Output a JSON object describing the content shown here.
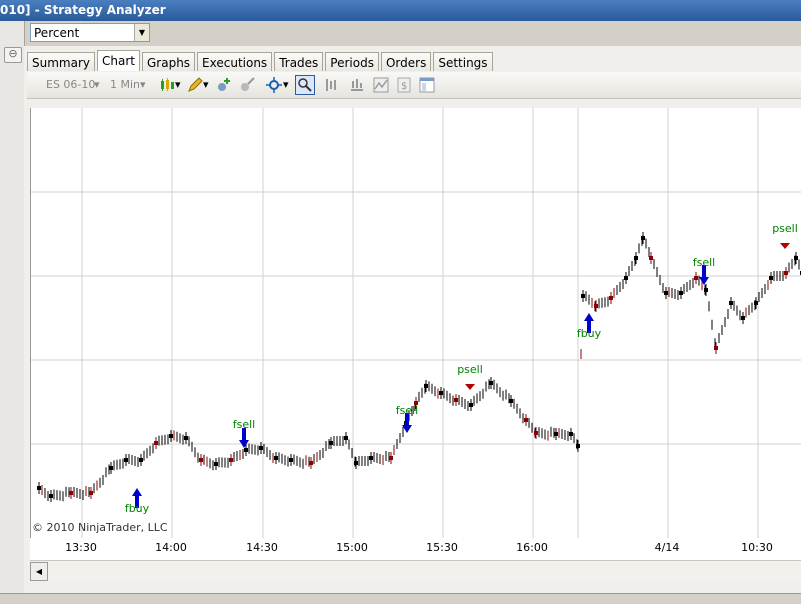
{
  "window": {
    "title": "010] - Strategy Analyzer"
  },
  "display_combo": {
    "value": "Percent"
  },
  "tabs": [
    "Summary",
    "Chart",
    "Graphs",
    "Executions",
    "Trades",
    "Periods",
    "Orders",
    "Settings"
  ],
  "active_tab": "Chart",
  "toolbar": {
    "instrument": "ES 06-10",
    "interval": "1 Min"
  },
  "chart": {
    "copyright": "© 2010 NinjaTrader, LLC",
    "x_labels": [
      {
        "text": "13:30"
      },
      {
        "text": "14:00"
      },
      {
        "text": "14:30"
      },
      {
        "text": "15:00"
      },
      {
        "text": "15:30"
      },
      {
        "text": "16:00"
      },
      {
        "text": "4/14"
      },
      {
        "text": "10:30"
      }
    ],
    "signals": [
      {
        "label": "fbuy",
        "type": "buy"
      },
      {
        "label": "fsell",
        "type": "sell"
      },
      {
        "label": "fsell",
        "type": "sell"
      },
      {
        "label": "psell",
        "type": "ptriangle"
      },
      {
        "label": "fbuy",
        "type": "buy"
      },
      {
        "label": "fsell",
        "type": "sell"
      },
      {
        "label": "psell",
        "type": "ptriangle"
      }
    ],
    "colors": {
      "up": "#000000",
      "down": "#8b0000",
      "grid": "#d0d0d0",
      "arrow": "#0000cc",
      "signal_text": "#008000",
      "triangle": "#b00000"
    }
  }
}
